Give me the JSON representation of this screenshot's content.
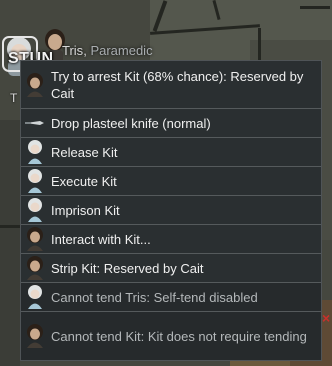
{
  "pawn_label": {
    "name": "Tris",
    "job": "Paramedic"
  },
  "status_label": "STUN",
  "tris_initial": "T",
  "world_marker": "×",
  "menu": {
    "items": [
      {
        "label": "Try to arrest Kit (68% chance): Reserved by Cait",
        "icon": "dark-pawn-icon",
        "disabled": false
      },
      {
        "label": "Drop plasteel knife (normal)",
        "icon": "knife-icon",
        "disabled": false
      },
      {
        "label": "Release Kit",
        "icon": "pale-pawn-icon",
        "disabled": false
      },
      {
        "label": "Execute Kit",
        "icon": "pale-pawn-icon",
        "disabled": false
      },
      {
        "label": "Imprison Kit",
        "icon": "pale-pawn-icon",
        "disabled": false
      },
      {
        "label": "Interact with Kit...",
        "icon": "dark-pawn-icon",
        "disabled": false
      },
      {
        "label": "Strip Kit: Reserved by Cait",
        "icon": "dark-pawn-icon",
        "disabled": false
      },
      {
        "label": "Cannot tend Tris: Self-tend disabled",
        "icon": "pale-pawn-icon",
        "disabled": true
      },
      {
        "label": "Cannot tend Kit: Kit does not require tending",
        "icon": "dark-pawn-icon",
        "disabled": true
      }
    ]
  },
  "colors": {
    "menu_bg": "#2a2f31",
    "menu_border": "#555a5c",
    "text": "#f0f0f0",
    "disabled_text": "#b4b8ba"
  }
}
